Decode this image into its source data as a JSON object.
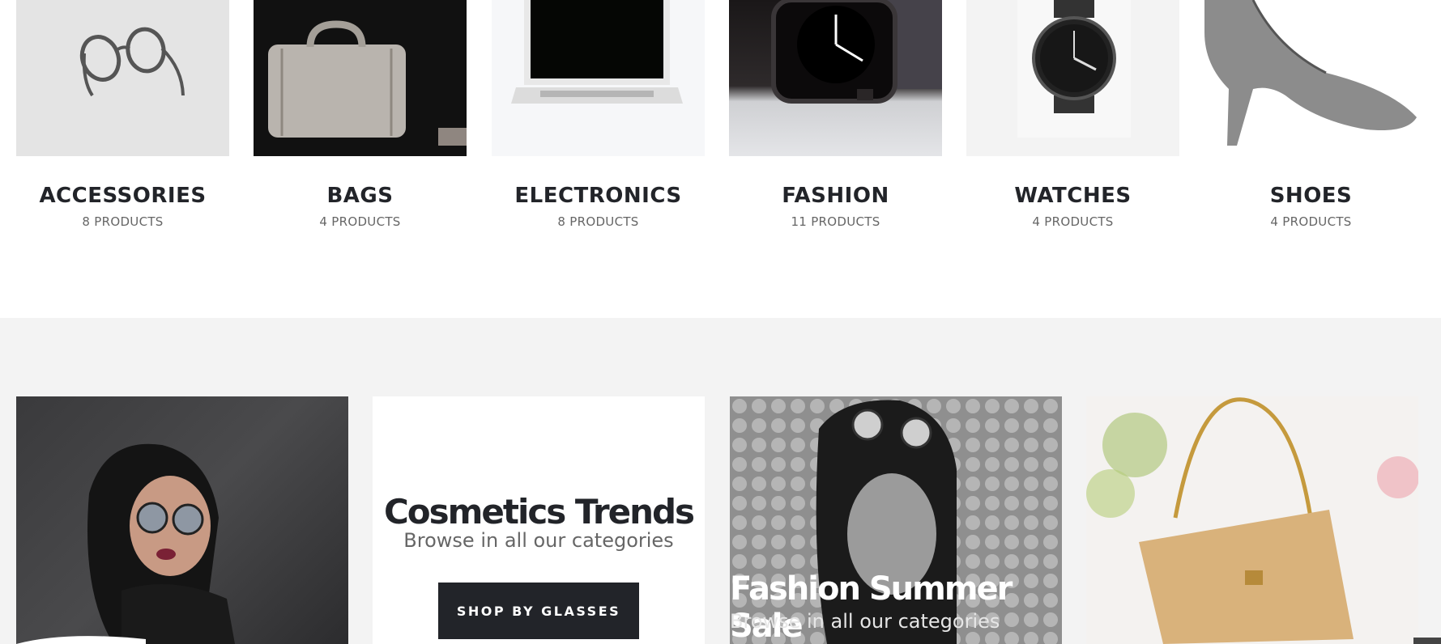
{
  "categories": [
    {
      "name": "ACCESSORIES",
      "count": "8 PRODUCTS",
      "icon": "glasses-image"
    },
    {
      "name": "BAGS",
      "count": "4 PRODUCTS",
      "icon": "bag-image"
    },
    {
      "name": "ELECTRONICS",
      "count": "8 PRODUCTS",
      "icon": "laptop-image"
    },
    {
      "name": "FASHION",
      "count": "11 PRODUCTS",
      "icon": "smartwatch-image"
    },
    {
      "name": "WATCHES",
      "count": "4 PRODUCTS",
      "icon": "watch-image"
    },
    {
      "name": "SHOES",
      "count": "4 PRODUCTS",
      "icon": "shoes-image"
    }
  ],
  "promo": {
    "cosmetics_title": "Cosmetics Trends",
    "cosmetics_sub": "Browse in all our categories",
    "shop_button": "SHOP BY GLASSES",
    "summer_title": "Fashion Summer Sale",
    "summer_sub": "Browse in all our categories"
  },
  "colors": {
    "dark": "#222429",
    "section_bg": "#f3f3f3",
    "muted": "#666666"
  }
}
